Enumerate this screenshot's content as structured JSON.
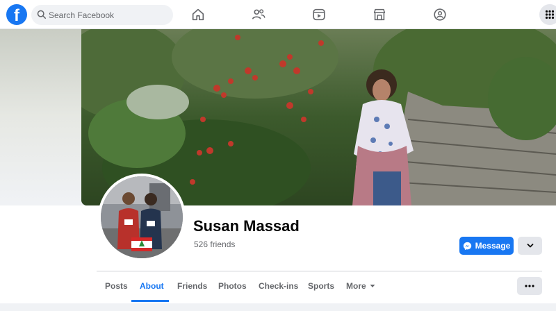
{
  "search": {
    "placeholder": "Search Facebook"
  },
  "profile": {
    "name": "Susan Massad",
    "friends": "526 friends"
  },
  "actions": {
    "message_label": "Message"
  },
  "tabs": [
    {
      "label": "Posts"
    },
    {
      "label": "About"
    },
    {
      "label": "Friends"
    },
    {
      "label": "Photos"
    },
    {
      "label": "Check-ins"
    },
    {
      "label": "Sports"
    },
    {
      "label": "More"
    }
  ],
  "active_tab": "About",
  "nav_icons": [
    "home-icon",
    "friends-icon",
    "video-icon",
    "marketplace-icon",
    "groups-icon",
    "menu-grid-icon"
  ],
  "colors": {
    "brand": "#1877f2",
    "background": "#f0f2f5",
    "text": "#050505",
    "secondary_text": "#65676b"
  }
}
